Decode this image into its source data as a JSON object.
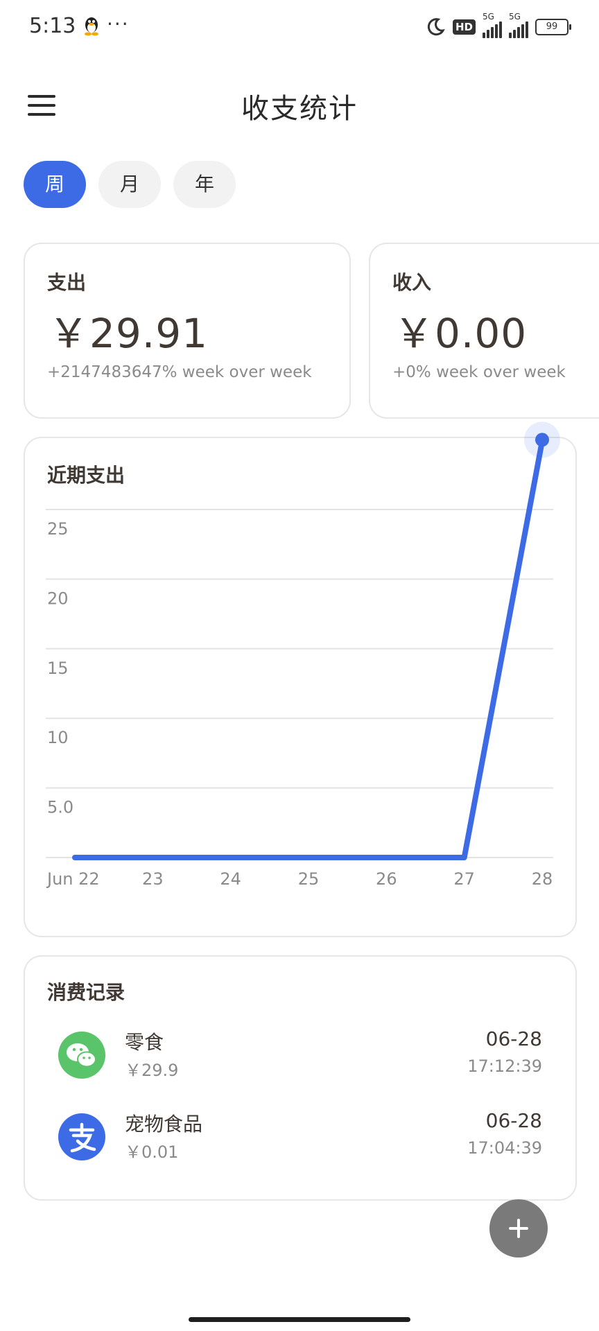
{
  "status_bar": {
    "time": "5:13",
    "more": "···",
    "hd_label": "HD",
    "network_1": "5G",
    "network_2": "5G",
    "battery": "99"
  },
  "header": {
    "title": "收支统计",
    "menu_icon": "menu-icon"
  },
  "period_tabs": [
    {
      "label": "周",
      "active": true
    },
    {
      "label": "月",
      "active": false
    },
    {
      "label": "年",
      "active": false
    }
  ],
  "summary": {
    "expense": {
      "label": "支出",
      "amount": "￥29.91",
      "change": "+2147483647% week over week"
    },
    "income": {
      "label": "收入",
      "amount": "￥0.00",
      "change": "+0% week over week"
    }
  },
  "chart": {
    "title": "近期支出",
    "accent_color": "#3d6be6"
  },
  "chart_data": {
    "type": "line",
    "title": "近期支出",
    "x": [
      "Jun 22",
      "23",
      "24",
      "25",
      "26",
      "27",
      "28"
    ],
    "series": [
      {
        "values": [
          0,
          0,
          0,
          0,
          0,
          0,
          29.91
        ]
      }
    ],
    "yticks": [
      "5.0",
      "10",
      "15",
      "20",
      "25"
    ],
    "ylim": [
      0,
      25
    ],
    "grid": true,
    "highlight_last_point": true
  },
  "records": {
    "title": "消费记录",
    "items": [
      {
        "name": "零食",
        "amount": "￥29.9",
        "date": "06-28",
        "time": "17:12:39",
        "icon": "wechat-pay-icon",
        "icon_color": "#5ac46b"
      },
      {
        "name": "宠物食品",
        "amount": "￥0.01",
        "date": "06-28",
        "time": "17:04:39",
        "icon": "alipay-icon",
        "icon_color": "#3d6be6"
      }
    ]
  },
  "fab": {
    "icon": "plus-icon"
  }
}
